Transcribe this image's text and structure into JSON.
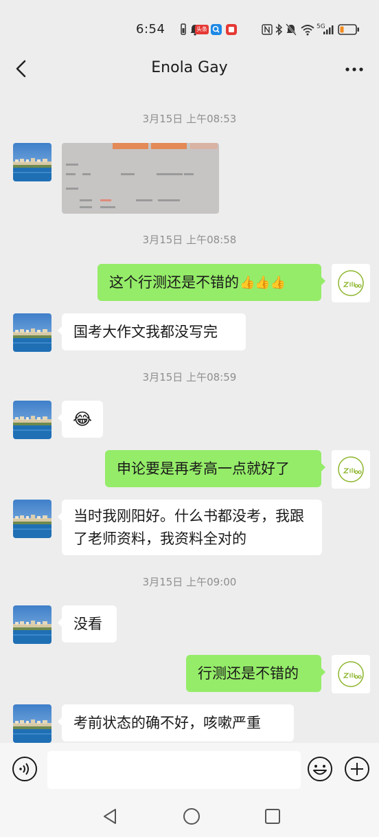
{
  "status_bar": {
    "time": "6:54",
    "badge_text": "头条",
    "network_label": "5G"
  },
  "header": {
    "title": "Enola Gay"
  },
  "timestamps": [
    "3月15日 上午08:53",
    "3月15日 上午08:58",
    "3月15日 上午08:59",
    "3月15日 上午09:00"
  ],
  "messages": [
    {
      "side": "left",
      "text": ""
    },
    {
      "side": "right",
      "text": "这个行测还是不错的"
    },
    {
      "side": "left",
      "text": "国考大作文我都没写完"
    },
    {
      "side": "left",
      "text": ""
    },
    {
      "side": "right",
      "text": "申论要是再考高一点就好了"
    },
    {
      "side": "left",
      "text": "当时我刚阳好。什么书都没考，我跟了老师资料，我资料全对的"
    },
    {
      "side": "left",
      "text": "没看"
    },
    {
      "side": "right",
      "text": "行测还是不错的"
    },
    {
      "side": "left",
      "text": "考前状态的确不好，咳嗽严重"
    }
  ],
  "emojis": {
    "thumbs_up": "👍",
    "laugh_cry": "😂"
  },
  "avatars": {
    "right_logo_text": "zilioo"
  },
  "input": {
    "placeholder": ""
  },
  "colors": {
    "background": "#ededed",
    "sent_bubble": "#95ec69",
    "received_bubble": "#ffffff",
    "timestamp_text": "#8e8e8e"
  }
}
